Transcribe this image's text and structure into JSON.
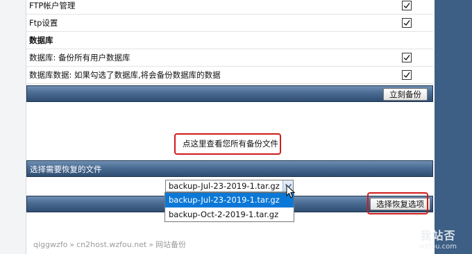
{
  "options": [
    {
      "label": "FTP帐户管理",
      "checked": true
    },
    {
      "label": "Ftp设置",
      "checked": true
    },
    {
      "label": "数据库",
      "section": true
    },
    {
      "label": "数据库: 备份所有用户数据库",
      "checked": true
    },
    {
      "label": "数据库数据: 如果勾选了数据库,将会备份数据库的数据",
      "checked": true
    }
  ],
  "backup_now_button": "立刻备份",
  "view_backups_link": "点这里查看您所有备份文件",
  "restore_section_title": "选择需要恢复的文件",
  "restore_select": {
    "value": "backup-Jul-23-2019-1.tar.gz",
    "options": [
      "backup-Jul-23-2019-1.tar.gz",
      "backup-Oct-2-2019-1.tar.gz"
    ]
  },
  "restore_button": "选择恢复选项",
  "breadcrumb": [
    "qiggwzfo",
    "cn2host.wzfou.net",
    "网站备份"
  ],
  "breadcrumb_separator": "»",
  "watermark": {
    "line1": "我站否",
    "line2": "wzfou.com"
  },
  "colors": {
    "bar": "#4a6b92",
    "panel": "#3e5f85",
    "highlight_border": "#d11a1a",
    "selected_option": "#0b78d7"
  }
}
